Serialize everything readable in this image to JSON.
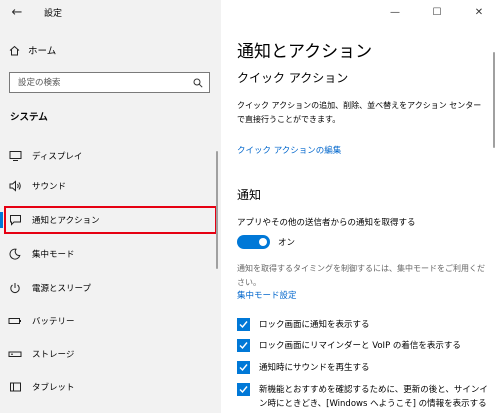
{
  "window": {
    "title": "設定",
    "back_glyph": "←",
    "controls": {
      "minimize": "—",
      "maximize": "☐",
      "close": "✕"
    }
  },
  "sidebar": {
    "home_label": "ホーム",
    "search_placeholder": "設定の検索",
    "section_label": "システム",
    "items": [
      {
        "label": "ディスプレイ",
        "icon": "display-icon"
      },
      {
        "label": "サウンド",
        "icon": "speaker-icon"
      },
      {
        "label": "通知とアクション",
        "icon": "notification-icon",
        "selected": true
      },
      {
        "label": "集中モード",
        "icon": "moon-icon"
      },
      {
        "label": "電源とスリープ",
        "icon": "power-icon"
      },
      {
        "label": "バッテリー",
        "icon": "battery-icon"
      },
      {
        "label": "ストレージ",
        "icon": "storage-icon"
      },
      {
        "label": "タブレット",
        "icon": "tablet-icon"
      }
    ]
  },
  "main": {
    "title": "通知とアクション",
    "quick_actions": {
      "heading": "クイック アクション",
      "description": "クイック アクションの追加、削除、並べ替えをアクション センターで直接行うことができます。",
      "edit_link": "クイック アクションの編集"
    },
    "notifications": {
      "heading": "通知",
      "get_label": "アプリやその他の送信者からの通知を取得する",
      "toggle_state": "オン",
      "focus_hint": "通知を取得するタイミングを制御するには、集中モードをご利用ください。",
      "focus_link": "集中モード設定",
      "checkboxes": [
        {
          "label": "ロック画面に通知を表示する",
          "checked": true
        },
        {
          "label": "ロック画面にリマインダーと VoIP の着信を表示する",
          "checked": true
        },
        {
          "label": "通知時にサウンドを再生する",
          "checked": true
        },
        {
          "label": "新機能とおすすめを確認するために、更新の後と、サインイン時にときどき、[Windows へようこそ] の情報を表示する",
          "checked": true
        }
      ]
    }
  },
  "colors": {
    "accent": "#0078d7",
    "link": "#0066cc",
    "highlight_border": "#e60012",
    "sidebar_bg": "#f2f2f2"
  }
}
